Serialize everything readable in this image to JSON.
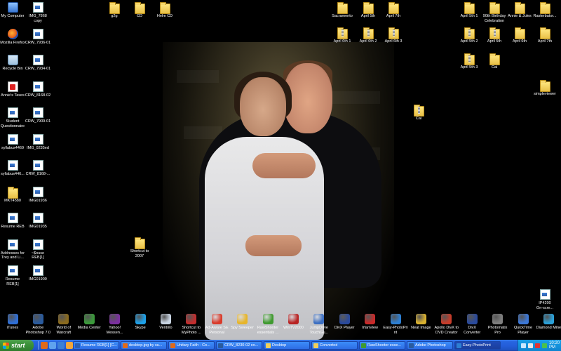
{
  "desktop": {
    "left_column": [
      {
        "label": "My Computer",
        "icon": "my-computer-icon"
      },
      {
        "label": "IMG_7868\ncopy",
        "icon": "image-file-icon"
      },
      {
        "label": "Mozilla Firefox",
        "icon": "firefox-icon"
      },
      {
        "label": "CRW_7936-01",
        "icon": "image-file-icon"
      },
      {
        "label": "Recycle Bin",
        "icon": "recycle-bin-icon"
      },
      {
        "label": "CRW_7934-01",
        "icon": "image-file-icon"
      },
      {
        "label": "Annie's Taxes",
        "icon": "pdf-icon"
      },
      {
        "label": "CRW_8168-02",
        "icon": "image-file-icon"
      },
      {
        "label": "Student\nQuestionnaire",
        "icon": "document-icon"
      },
      {
        "label": "CRW_7909-01",
        "icon": "image-file-icon"
      },
      {
        "label": "syllabus4469",
        "icon": "document-icon"
      },
      {
        "label": "IMG_0235ed",
        "icon": "image-file-icon"
      },
      {
        "label": "syllabus446...",
        "icon": "document-icon"
      },
      {
        "label": "CRW_8168-...",
        "icon": "image-file-icon"
      },
      {
        "label": "MKT4580",
        "icon": "folder-icon"
      },
      {
        "label": "IMG01936",
        "icon": "image-file-icon"
      },
      {
        "label": "Resume REB",
        "icon": "document-icon"
      },
      {
        "label": "IMG01935",
        "icon": "image-file-icon"
      },
      {
        "label": "Addresses for\nTrey and Li...",
        "icon": "document-icon"
      },
      {
        "label": "~$ouse\nREB[1]",
        "icon": "document-icon"
      },
      {
        "label": "Resume\nREB[1]",
        "icon": "document-icon"
      },
      {
        "label": "IMG01909",
        "icon": "image-file-icon"
      }
    ],
    "top_folders": [
      {
        "label": "g2g",
        "icon": "folder-icon"
      },
      {
        "label": "CD",
        "icon": "folder-icon"
      },
      {
        "label": "Helm CD",
        "icon": "folder-icon"
      }
    ],
    "shortcut_2007": {
      "label": "Shortcut to\n2007",
      "icon": "folder-shortcut-icon"
    },
    "middle_folders": [
      {
        "label": "Sacramento",
        "icon": "folder-icon"
      },
      {
        "label": "April 5th",
        "icon": "folder-icon"
      },
      {
        "label": "April 7th",
        "icon": "folder-icon"
      },
      {
        "label": "April 6th 1",
        "icon": "zip-folder-icon"
      },
      {
        "label": "April 6th 2",
        "icon": "zip-folder-icon"
      },
      {
        "label": "April 6th 3",
        "icon": "zip-folder-icon"
      },
      {
        "label": "Cai",
        "icon": "zip-folder-icon"
      }
    ],
    "right_folders": [
      {
        "label": "April 5th 1",
        "icon": "folder-icon"
      },
      {
        "label": "90th Birthday\nCelebration",
        "icon": "folder-icon"
      },
      {
        "label": "Annie & Jules",
        "icon": "folder-icon"
      },
      {
        "label": "Rasterbator...",
        "icon": "folder-icon"
      },
      {
        "label": "April 5th 2",
        "icon": "zip-folder-icon"
      },
      {
        "label": "April 5th",
        "icon": "zip-folder-icon"
      },
      {
        "label": "April 6th",
        "icon": "folder-icon"
      },
      {
        "label": "April 7th",
        "icon": "folder-icon"
      },
      {
        "label": "April 5th 3",
        "icon": "zip-folder-icon"
      },
      {
        "label": "Cai",
        "icon": "folder-icon"
      },
      {
        "label": "simpleviewer",
        "icon": "folder-icon"
      },
      {
        "label": "IP4200\nOn-scre...",
        "icon": "printer-icon"
      }
    ],
    "bottom_row": [
      {
        "label": "iTunes",
        "icon": "itunes-icon",
        "color": "#2f6fd6"
      },
      {
        "label": "Adobe\nPhotoshop 7.0",
        "icon": "photoshop-icon",
        "color": "#2a5b9e"
      },
      {
        "label": "World of\nWarcraft",
        "icon": "warcraft-icon",
        "color": "#8a6a1e"
      },
      {
        "label": "Media Center",
        "icon": "media-center-icon",
        "color": "#3b9a3b"
      },
      {
        "label": "Yahoo!\nMessen...",
        "icon": "yahoo-messenger-icon",
        "color": "#7b2fa0"
      },
      {
        "label": "Skype",
        "icon": "skype-icon",
        "color": "#1ea0e8"
      },
      {
        "label": "Ventrilo",
        "icon": "ventrilo-icon",
        "color": "#c9d5e3"
      },
      {
        "label": "Shortcut to\nMyPhoto ...",
        "icon": "myphoto-icon",
        "color": "#c22e2e"
      },
      {
        "label": "Ad-Aware SE\nPersonal",
        "icon": "ad-aware-icon",
        "color": "#d93b2b"
      },
      {
        "label": "Spy Sweeper",
        "icon": "spy-sweeper-icon",
        "color": "#e7b52a"
      },
      {
        "label": "RawShooter\nessentials ...",
        "icon": "rawshooter-icon",
        "color": "#3f9a2f"
      },
      {
        "label": "WinTV2000",
        "icon": "wintv-icon",
        "color": "#b82222"
      },
      {
        "label": "JumpDrive\nTouchGu...",
        "icon": "jumpdrive-icon",
        "color": "#3c6fc2"
      },
      {
        "label": "DivX Player",
        "icon": "divx-player-icon",
        "color": "#2a4a9c"
      },
      {
        "label": "IrfanView",
        "icon": "irfanview-icon",
        "color": "#c92a2a"
      },
      {
        "label": "Easy-PhotoPri\nnt",
        "icon": "easy-photoprint-icon",
        "color": "#2d7fd3"
      },
      {
        "label": "Neat Image",
        "icon": "neat-image-icon",
        "color": "#d8b030"
      },
      {
        "label": "Apollo DivX to\nDVD Creator",
        "icon": "apollo-icon",
        "color": "#c73c2a"
      },
      {
        "label": "DivX\nConverter",
        "icon": "divx-converter-icon",
        "color": "#2a4a9c"
      },
      {
        "label": "Photomatix\nPro",
        "icon": "photomatix-icon",
        "color": "#7f7f7f"
      },
      {
        "label": "QuickTime\nPlayer",
        "icon": "quicktime-icon",
        "color": "#3c78d8"
      },
      {
        "label": "Diamond Mine",
        "icon": "diamond-mine-icon",
        "color": "#2aa0d8"
      }
    ]
  },
  "taskbar": {
    "start_label": "start",
    "quicklaunch": [
      {
        "icon": "firefox-icon",
        "color": "#e06a1a"
      },
      {
        "icon": "show-desktop-icon",
        "color": "#5fa3ee"
      },
      {
        "icon": "ie-icon",
        "color": "#3c7fd6"
      },
      {
        "icon": "media-player-icon",
        "color": "#f2a63a"
      }
    ],
    "tasks": [
      {
        "label": "Resume REB[1] [C...",
        "icon": "word-icon",
        "color": "#2b5fb4"
      },
      {
        "label": "desktop.jpg by su...",
        "icon": "firefox-icon",
        "color": "#e06a1a"
      },
      {
        "label": "Unitary Faith - Co...",
        "icon": "firefox-icon",
        "color": "#e06a1a"
      },
      {
        "label": "CRW_8230-02 co...",
        "icon": "photoshop-icon",
        "color": "#2a5b9e"
      },
      {
        "label": "Desktop",
        "icon": "folder-icon",
        "color": "#f2cf5b"
      },
      {
        "label": "Converted",
        "icon": "folder-icon",
        "color": "#f2cf5b"
      },
      {
        "label": "RawShooter esse...",
        "icon": "rawshooter-icon",
        "color": "#3f9a2f"
      },
      {
        "label": "Adobe Photoshop",
        "icon": "photoshop-icon",
        "color": "#2a5b9e"
      },
      {
        "label": "Easy-PhotoPrint",
        "icon": "easy-photoprint-icon",
        "color": "#2d7fd3",
        "active": true
      }
    ],
    "tray": {
      "icons": [
        {
          "icon": "network-icon",
          "color": "#c9e7ff"
        },
        {
          "icon": "volume-icon",
          "color": "#e8e8e8"
        },
        {
          "icon": "antivirus-icon",
          "color": "#d33"
        },
        {
          "icon": "messenger-icon",
          "color": "#4ac14a"
        }
      ],
      "clock": "10:20 PM"
    }
  }
}
